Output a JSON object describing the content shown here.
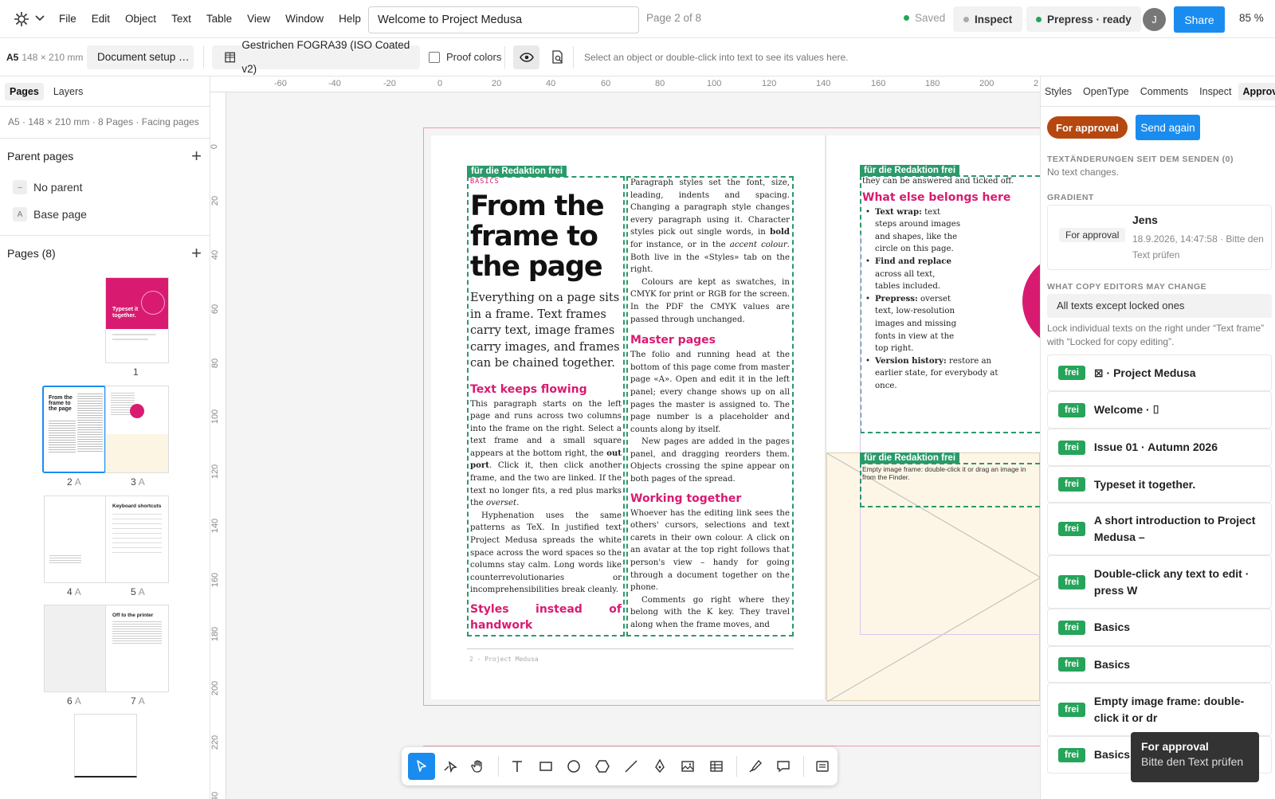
{
  "menu": {
    "items": [
      "File",
      "Edit",
      "Object",
      "Text",
      "Table",
      "View",
      "Window",
      "Help"
    ]
  },
  "document": {
    "title": "Welcome to Project Medusa",
    "page_indicator": "Page 2 of 8",
    "saved": "Saved",
    "inspect": "Inspect",
    "prepress": "Prepress · ready",
    "avatar": "J",
    "share": "Share",
    "zoom": "85 %"
  },
  "toolbar": {
    "format": "A5",
    "format_size": "148 × 210 mm",
    "doc_setup": "Document setup …",
    "profile": "Gestrichen FOGRA39 (ISO Coated v2)",
    "proof_colors": "Proof colors",
    "hint": "Select an object or double-click into text to see its values here."
  },
  "left": {
    "tabs": [
      "Pages",
      "Layers"
    ],
    "doc_info": "A5 · 148 × 210 mm · 8 Pages · Facing pages",
    "parent_pages_title": "Parent pages",
    "parents": [
      {
        "icon": "–",
        "label": "No parent"
      },
      {
        "icon": "A",
        "label": "Base page"
      }
    ],
    "pages_title": "Pages (8)",
    "thumb_labels": [
      {
        "n": "1",
        "m": ""
      },
      {
        "n": "2",
        "m": "A"
      },
      {
        "n": "3",
        "m": "A"
      },
      {
        "n": "4",
        "m": "A"
      },
      {
        "n": "5",
        "m": "A"
      },
      {
        "n": "6",
        "m": "A"
      },
      {
        "n": "7",
        "m": "A"
      }
    ],
    "thumb_texts": {
      "p1": "Typeset it together.",
      "p2": "From the frame to the page",
      "p5": "Keyboard shortcuts",
      "p7": "Off to the printer"
    }
  },
  "ruler": {
    "h": [
      "-60",
      "-40",
      "-20",
      "0",
      "20",
      "40",
      "60",
      "80",
      "100",
      "120",
      "140",
      "160",
      "180",
      "200",
      "2"
    ],
    "v": [
      "0",
      "20",
      "40",
      "60",
      "80",
      "100",
      "120",
      "140",
      "160",
      "180",
      "200",
      "220",
      "40"
    ]
  },
  "canvas": {
    "tag": "für die Redaktion frei",
    "kicker": "BASICS",
    "headline": "From the frame to the page",
    "lead": "Everything on a page sits in a frame. Text frames carry text, image frames carry images, and frames can be chained together.",
    "h_flow": "Text keeps flowing",
    "p_flow_1": "This paragraph starts on the left page and runs across two columns into the frame on the right. Select a text frame and a small square appears at the bottom right, the",
    "out_port": "out port",
    "p_flow_2": ". Click it, then click another frame, and the two are linked. If the text no longer fits, a red plus marks the",
    "overset": "overset",
    "p_hyph": "Hyphenation uses the same patterns as TeX. In justified text Project Medusa spreads the white space across the word spaces so the columns stay calm. Long words like counterrevolutionaries or incomprehensibilities break cleanly.",
    "h_styles": "Styles instead of handwork",
    "p_styles_1": "Paragraph styles set the font, size, leading, indents and spacing. Changing a paragraph style changes every paragraph using it. Character styles pick out single words, in",
    "bold": "bold",
    "p_styles_2": " for instance, or in the",
    "accent": "accent colour",
    "p_styles_3": ". Both live in the «Styles» tab on the right.",
    "p_colours": "Colours are kept as swatches, in CMYK for print or RGB for the screen. In the PDF the CMYK values are passed through unchanged.",
    "h_master": "Master pages",
    "p_master": "The folio and running head at the bottom of this page come from master page «A». Open and edit it in the left panel; every change shows up on all pages the master is assigned to. The page number is a placeholder and counts along by itself.",
    "p_newpages": "New pages are added in the pages panel, and dragging reorders them. Objects crossing the spine appear on both pages of the spread.",
    "h_working": "Working together",
    "p_working": "Whoever has the editing link sees the others' cursors, selections and text carets in their own colour. A click on an avatar at the top right follows that person's view – handy for going through a document together on the phone.",
    "p_comments": "Comments go right where they belong with the K key. They travel along when the frame moves, and",
    "folio": "2 · Project Medusa",
    "r_top": "they can be answered and ticked off.",
    "h_else": "What else belongs here",
    "b1_t": "Text wrap:",
    "b1": " text steps around images and shapes, like the circle on this page.",
    "b2_t": "Find and replace",
    "b2": " across all text, tables included.",
    "b3_t": "Prepress:",
    "b3": " overset text, low-resolution images and missing fonts in view at the top right.",
    "b4_t": "Version history:",
    "b4": " restore an earlier state, for everybody at once.",
    "empty_frame": "Empty image frame: double-click it or drag an image in from the Finder."
  },
  "right": {
    "tabs": [
      "Styles",
      "OpenType",
      "Comments",
      "Inspect",
      "Approval"
    ],
    "status": "For approval",
    "send_again": "Send again",
    "changes_label": "TEXTÄNDERUNGEN SEIT DEM SENDEN (0)",
    "changes_value": "No text changes.",
    "gradient_label": "GRADIENT",
    "user": "Jens",
    "user_tag": "For approval",
    "user_date": "18.9.2026, 14:47:58 · Bitte den",
    "user_date2": "Text prüfen",
    "may_change_label": "WHAT COPY EDITORS MAY CHANGE",
    "may_change_value": "All texts except locked ones",
    "lock_hint": "Lock individual texts on the right under “Text frame” with “Locked for copy editing”.",
    "badge": "frei",
    "texts": [
      "⊠ · Project Medusa",
      "Welcome · ⌷",
      "Issue 01 · Autumn 2026",
      "Typeset it together.",
      "A short introduction to Project Medusa –",
      "Double-click any text to edit · press W",
      "Basics",
      "Basics",
      "Empty image frame: double-click it or dr",
      "Basics"
    ]
  },
  "tooltip": {
    "title": "For approval",
    "text": "Bitte den Text prüfen"
  },
  "colors": {
    "accent": "#1a8cf0",
    "magenta": "#d81b71",
    "green": "#2a9a6a",
    "approval": "#b5470f"
  }
}
